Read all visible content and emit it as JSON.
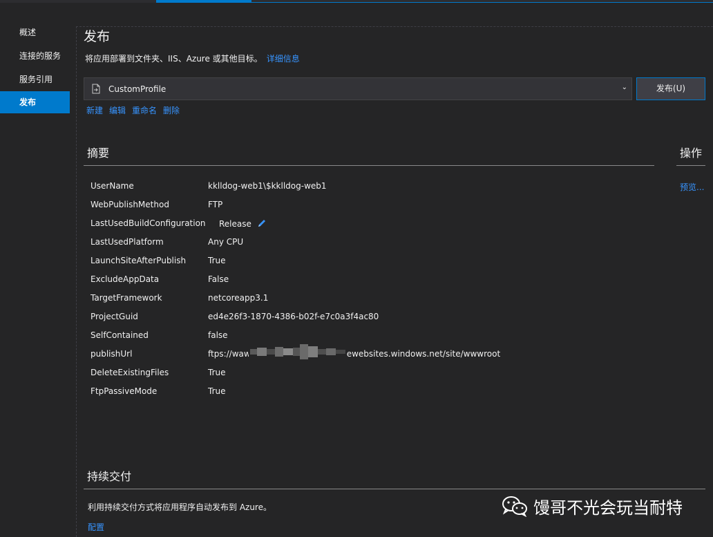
{
  "sidebar": {
    "items": [
      {
        "label": "概述"
      },
      {
        "label": "连接的服务"
      },
      {
        "label": "服务引用"
      },
      {
        "label": "发布",
        "active": true
      }
    ]
  },
  "page": {
    "title": "发布",
    "subtitle": "将应用部署到文件夹、IIS、Azure 或其他目标。",
    "details_link": "详细信息"
  },
  "profile": {
    "selected": "CustomProfile",
    "publish_button": "发布(U)",
    "actions": [
      "新建",
      "编辑",
      "重命名",
      "删除"
    ]
  },
  "summary": {
    "heading": "摘要",
    "properties": [
      {
        "name": "UserName",
        "value": "kklldog-web1\\$kklldog-web1"
      },
      {
        "name": "WebPublishMethod",
        "value": "FTP"
      },
      {
        "name": "LastUsedBuildConfiguration",
        "value": "Release"
      },
      {
        "name": "LastUsedPlatform",
        "value": "Any CPU"
      },
      {
        "name": "LaunchSiteAfterPublish",
        "value": "True"
      },
      {
        "name": "ExcludeAppData",
        "value": "False"
      },
      {
        "name": "TargetFramework",
        "value": "netcoreapp3.1"
      },
      {
        "name": "ProjectGuid",
        "value": "ed4e26f3-1870-4386-b02f-e7c0a3f4ac80"
      },
      {
        "name": "SelfContained",
        "value": "false"
      },
      {
        "name": "publishUrl",
        "value": "ftps://waws-prod-xxx-xxx.ftp.azurewebsites.windows.net/site/wwwroot"
      },
      {
        "name": "DeleteExistingFiles",
        "value": "True"
      },
      {
        "name": "FtpPassiveMode",
        "value": "True"
      }
    ]
  },
  "operations": {
    "heading": "操作",
    "preview_link": "预览..."
  },
  "cd": {
    "heading": "持续交付",
    "description": "利用持续交付方式将应用程序自动发布到 Azure。",
    "configure_link": "配置"
  },
  "watermark": {
    "text": "馒哥不光会玩当耐特"
  },
  "colors": {
    "accent": "#007acc",
    "link": "#3794ff",
    "background": "#252526"
  }
}
